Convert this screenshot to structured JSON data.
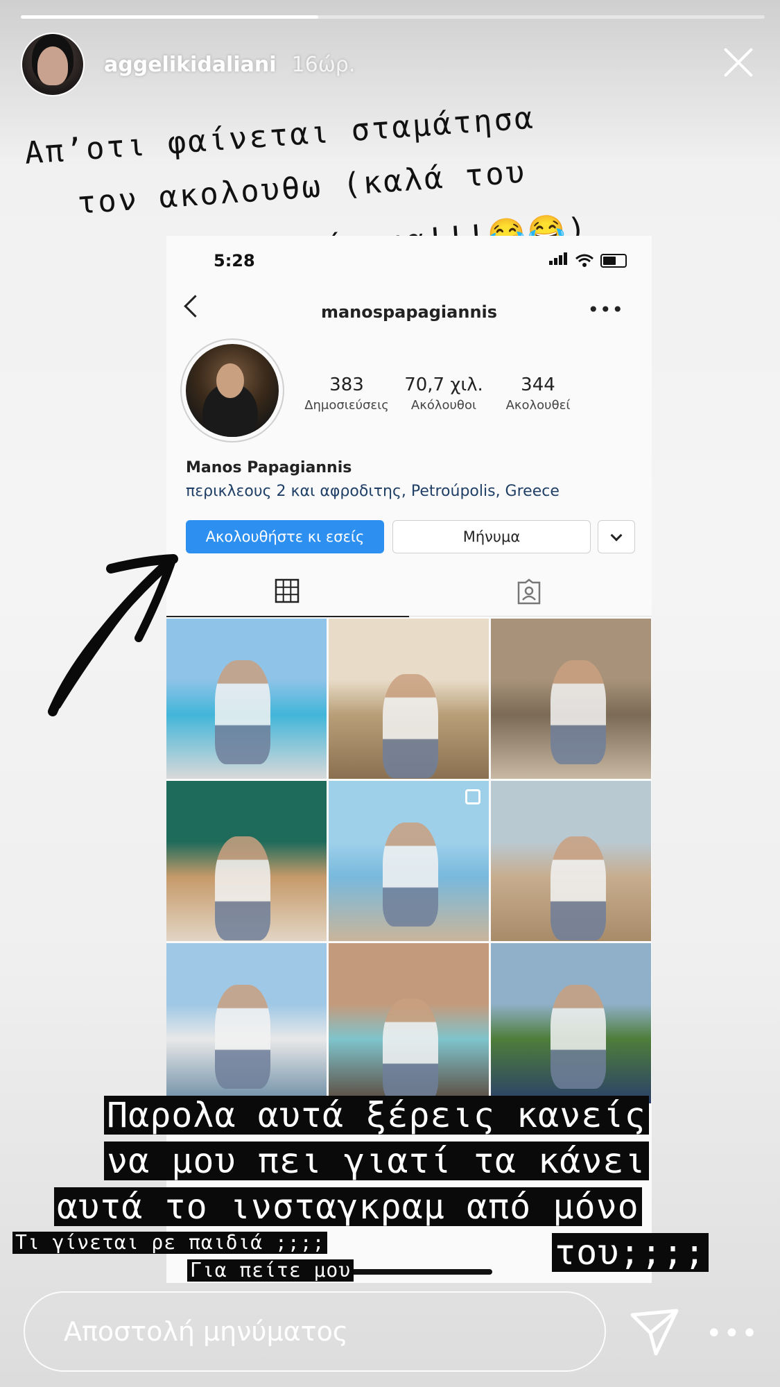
{
  "story": {
    "progress_fraction": 0.4,
    "username": "aggelikidaliani",
    "time_ago": "16ώρ.",
    "handwritten": [
      "Απ’οτι φαίνεται σταμάτησα",
      "τον ακολουθω  (καλά του",
      "έκανα!!!😂😂)"
    ]
  },
  "screenshot": {
    "status_time": "5:28",
    "profile_username": "manospapagiannis",
    "more_glyph": "•••",
    "stats": [
      {
        "value": "383",
        "label": "Δημοσιεύσεις"
      },
      {
        "value": "70,7 χιλ.",
        "label": "Ακόλουθοι"
      },
      {
        "value": "344",
        "label": "Ακολουθεί"
      }
    ],
    "name": "Manos Papagiannis",
    "location": "περικλεους 2 και αφροδιτης, Petroúpolis, Greece",
    "follow_label": "Ακολουθήστε κι εσείς",
    "message_label": "Μήνυμα",
    "follow_color": "#2d8ff0",
    "tabs": [
      "grid-icon",
      "tagged-icon"
    ],
    "posts": [
      {
        "icon": "pool-photo",
        "colors": [
          "#8fc3e8",
          "#42b6d9",
          "#d9d9d9"
        ]
      },
      {
        "icon": "field-photo",
        "colors": [
          "#e8dcc8",
          "#b99f78",
          "#8a7050"
        ]
      },
      {
        "icon": "stone-wall-photo",
        "colors": [
          "#a8937a",
          "#7b6a55",
          "#c8b9a4"
        ]
      },
      {
        "icon": "restaurant-photo",
        "colors": [
          "#1f6b5b",
          "#c69a6a",
          "#e2d5c4"
        ]
      },
      {
        "icon": "beach-photo",
        "colors": [
          "#9fd0ea",
          "#78b9dd",
          "#c9b59a"
        ]
      },
      {
        "icon": "sand-photo",
        "colors": [
          "#b9c9d2",
          "#c7ad8e",
          "#a88b69"
        ]
      },
      {
        "icon": "sea-hat-photo",
        "colors": [
          "#9ec8e6",
          "#e8e8e8",
          "#6a8ca4"
        ]
      },
      {
        "icon": "closeup-photo",
        "colors": [
          "#c49a7c",
          "#7fc4cc",
          "#5a463a"
        ]
      },
      {
        "icon": "garden-photo",
        "colors": [
          "#8fb0c8",
          "#4e7d3a",
          "#2a3f6a"
        ]
      }
    ]
  },
  "captions": {
    "big_lines": [
      "Παρολα αυτά ξέρεις κανείς",
      "να μου πει γιατί τα κάνει",
      "αυτά το ινσταγκραμ από μόνο",
      "του;;;;"
    ],
    "small_lines": [
      "Τι γίνεται ρε παιδιά ;;;;",
      "Για πείτε μου"
    ]
  },
  "reply": {
    "placeholder": "Αποστολή μηνύματος",
    "more_glyph": "•••"
  }
}
